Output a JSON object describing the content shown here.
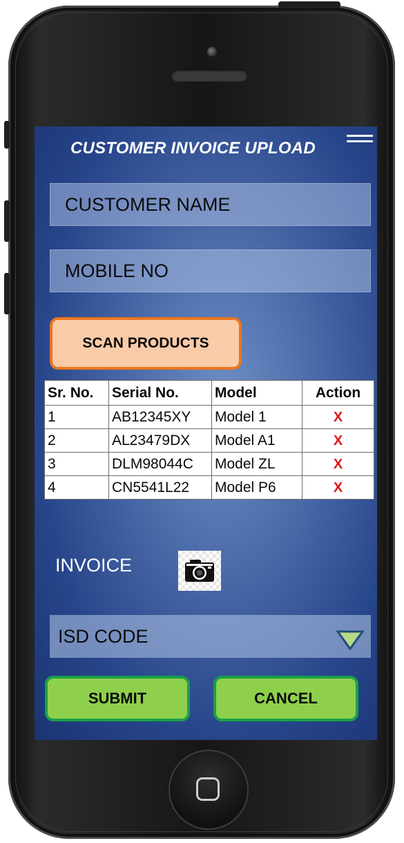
{
  "app": {
    "title": "CUSTOMER INVOICE UPLOAD"
  },
  "form": {
    "customer_name_placeholder": "CUSTOMER NAME",
    "mobile_no_placeholder": "MOBILE NO",
    "scan_button_label": "SCAN PRODUCTS",
    "invoice_label": "INVOICE",
    "isd_code_label": "ISD CODE",
    "submit_label": "SUBMIT",
    "cancel_label": "CANCEL"
  },
  "table": {
    "headers": [
      "Sr. No.",
      "Serial No.",
      "Model",
      "Action"
    ],
    "rows": [
      {
        "sr": "1",
        "serial": "AB12345XY",
        "model": "Model 1",
        "action": "X"
      },
      {
        "sr": "2",
        "serial": "AL23479DX",
        "model": "Model A1",
        "action": "X"
      },
      {
        "sr": "3",
        "serial": "DLM98044C",
        "model": "Model ZL",
        "action": "X"
      },
      {
        "sr": "4",
        "serial": "CN5541L22",
        "model": "Model P6",
        "action": "X"
      }
    ]
  },
  "icons": {
    "menu": "hamburger-menu-icon",
    "camera": "camera-icon",
    "dropdown": "triangle-down-icon",
    "delete": "x-icon",
    "home": "home-button-icon"
  },
  "colors": {
    "screen_bg": "#3f5fa0",
    "scan_button_fill": "#f9cba8",
    "scan_button_border": "#e9761f",
    "action_button_fill": "#8ed04c",
    "action_button_border": "#1aa04a",
    "delete_icon": "#e01414",
    "dropdown_fill": "#b8d88a",
    "dropdown_stroke": "#1f4e78"
  }
}
